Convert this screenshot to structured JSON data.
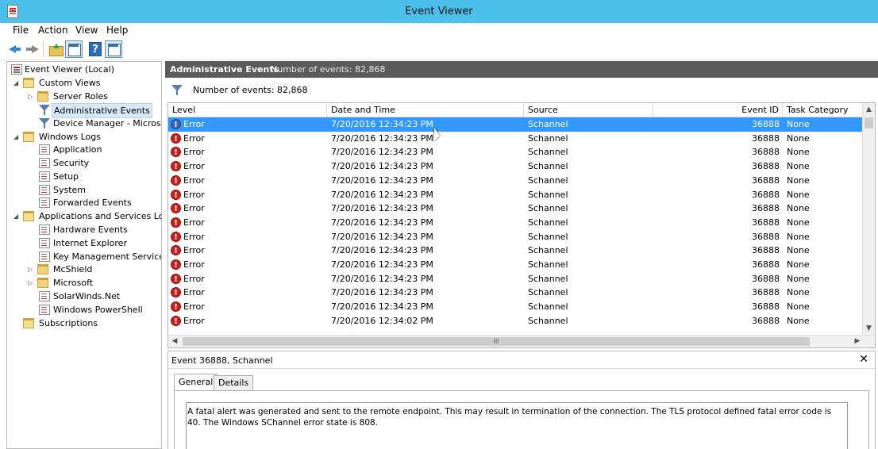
{
  "window": {
    "title": "Event Viewer"
  },
  "menu": [
    "File",
    "Action",
    "View",
    "Help"
  ],
  "toolbar": {
    "buttons": [
      "back-icon",
      "forward-icon",
      "up-folder-icon",
      "show-hide-console-tree-icon",
      "help-icon",
      "show-hide-action-pane-icon"
    ],
    "help_glyph": "?"
  },
  "tree": {
    "root": "Event Viewer (Local)",
    "custom_views": "Custom Views",
    "server_roles": "Server Roles",
    "administrative_events": "Administrative Events",
    "device_manager": "Device Manager - Microsoft",
    "windows_logs": "Windows Logs",
    "application": "Application",
    "security": "Security",
    "setup": "Setup",
    "system": "System",
    "forwarded_events": "Forwarded Events",
    "apps_services_logs": "Applications and Services Logs",
    "hardware_events": "Hardware Events",
    "internet_explorer": "Internet Explorer",
    "key_management_service": "Key Management Service",
    "mcshield": "McShield",
    "microsoft": "Microsoft",
    "solarwinds": "SolarWinds.Net",
    "windows_powershell": "Windows PowerShell",
    "subscriptions": "Subscriptions"
  },
  "panel": {
    "title": "Administrative Events",
    "count_text": "Number of events: 82,868",
    "filter_text": "Number of events: 82,868"
  },
  "grid": {
    "columns": {
      "level": "Level",
      "datetime": "Date and Time",
      "source": "Source",
      "event_id": "Event ID",
      "task_category": "Task Category"
    },
    "rows": [
      {
        "level": "Error",
        "datetime": "7/20/2016 12:34:23 PM",
        "source": "Schannel",
        "event_id": "36888",
        "task": "None"
      },
      {
        "level": "Error",
        "datetime": "7/20/2016 12:34:23 PM",
        "source": "Schannel",
        "event_id": "36888",
        "task": "None"
      },
      {
        "level": "Error",
        "datetime": "7/20/2016 12:34:23 PM",
        "source": "Schannel",
        "event_id": "36888",
        "task": "None"
      },
      {
        "level": "Error",
        "datetime": "7/20/2016 12:34:23 PM",
        "source": "Schannel",
        "event_id": "36888",
        "task": "None"
      },
      {
        "level": "Error",
        "datetime": "7/20/2016 12:34:23 PM",
        "source": "Schannel",
        "event_id": "36888",
        "task": "None"
      },
      {
        "level": "Error",
        "datetime": "7/20/2016 12:34:23 PM",
        "source": "Schannel",
        "event_id": "36888",
        "task": "None"
      },
      {
        "level": "Error",
        "datetime": "7/20/2016 12:34:23 PM",
        "source": "Schannel",
        "event_id": "36888",
        "task": "None"
      },
      {
        "level": "Error",
        "datetime": "7/20/2016 12:34:23 PM",
        "source": "Schannel",
        "event_id": "36888",
        "task": "None"
      },
      {
        "level": "Error",
        "datetime": "7/20/2016 12:34:23 PM",
        "source": "Schannel",
        "event_id": "36888",
        "task": "None"
      },
      {
        "level": "Error",
        "datetime": "7/20/2016 12:34:23 PM",
        "source": "Schannel",
        "event_id": "36888",
        "task": "None"
      },
      {
        "level": "Error",
        "datetime": "7/20/2016 12:34:23 PM",
        "source": "Schannel",
        "event_id": "36888",
        "task": "None"
      },
      {
        "level": "Error",
        "datetime": "7/20/2016 12:34:23 PM",
        "source": "Schannel",
        "event_id": "36888",
        "task": "None"
      },
      {
        "level": "Error",
        "datetime": "7/20/2016 12:34:23 PM",
        "source": "Schannel",
        "event_id": "36888",
        "task": "None"
      },
      {
        "level": "Error",
        "datetime": "7/20/2016 12:34:23 PM",
        "source": "Schannel",
        "event_id": "36888",
        "task": "None"
      },
      {
        "level": "Error",
        "datetime": "7/20/2016 12:34:02 PM",
        "source": "Schannel",
        "event_id": "36888",
        "task": "None"
      }
    ],
    "selected_row": 0,
    "hscroll_grip": "III"
  },
  "details": {
    "title": "Event 36888, Schannel",
    "close_glyph": "✕",
    "tabs": [
      "General",
      "Details"
    ],
    "active_tab": "General",
    "description": "A fatal alert was generated and sent to the remote endpoint. This may result in termination of the connection. The TLS protocol defined fatal error code is 40. The Windows SChannel error state is 808."
  }
}
